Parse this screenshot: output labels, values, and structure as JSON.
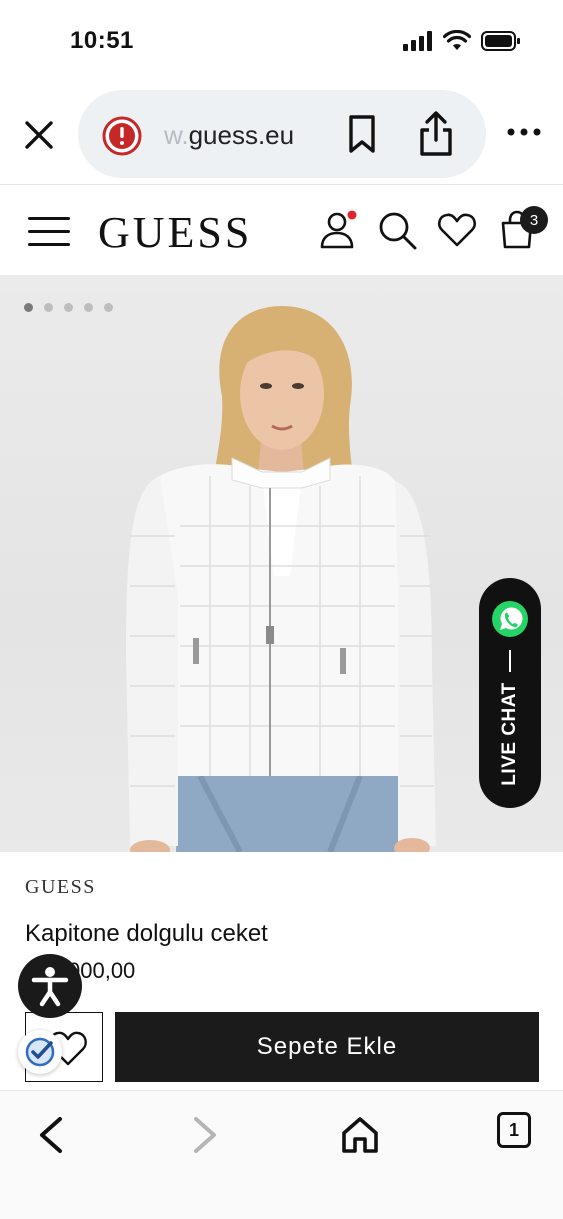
{
  "status_bar": {
    "time": "10:51"
  },
  "browser": {
    "url_prefix": "w.",
    "url_domain": "guess.eu"
  },
  "header": {
    "logo": "GUESS",
    "cart_count": "3"
  },
  "hero": {
    "slide_count": 5,
    "active_slide": 1,
    "live_chat_label": "LIVE CHAT"
  },
  "product": {
    "brand": "GUESS",
    "name": "Kapitone dolgulu ceket",
    "price": "000,00",
    "add_to_cart_label": "Sepete Ekle"
  },
  "toolbar": {
    "tabs_count": "1"
  },
  "colors": {
    "accent_dot": "#e0242b",
    "button_dark": "#1b1b1b",
    "whatsapp": "#25d366",
    "warning": "#c62828"
  }
}
